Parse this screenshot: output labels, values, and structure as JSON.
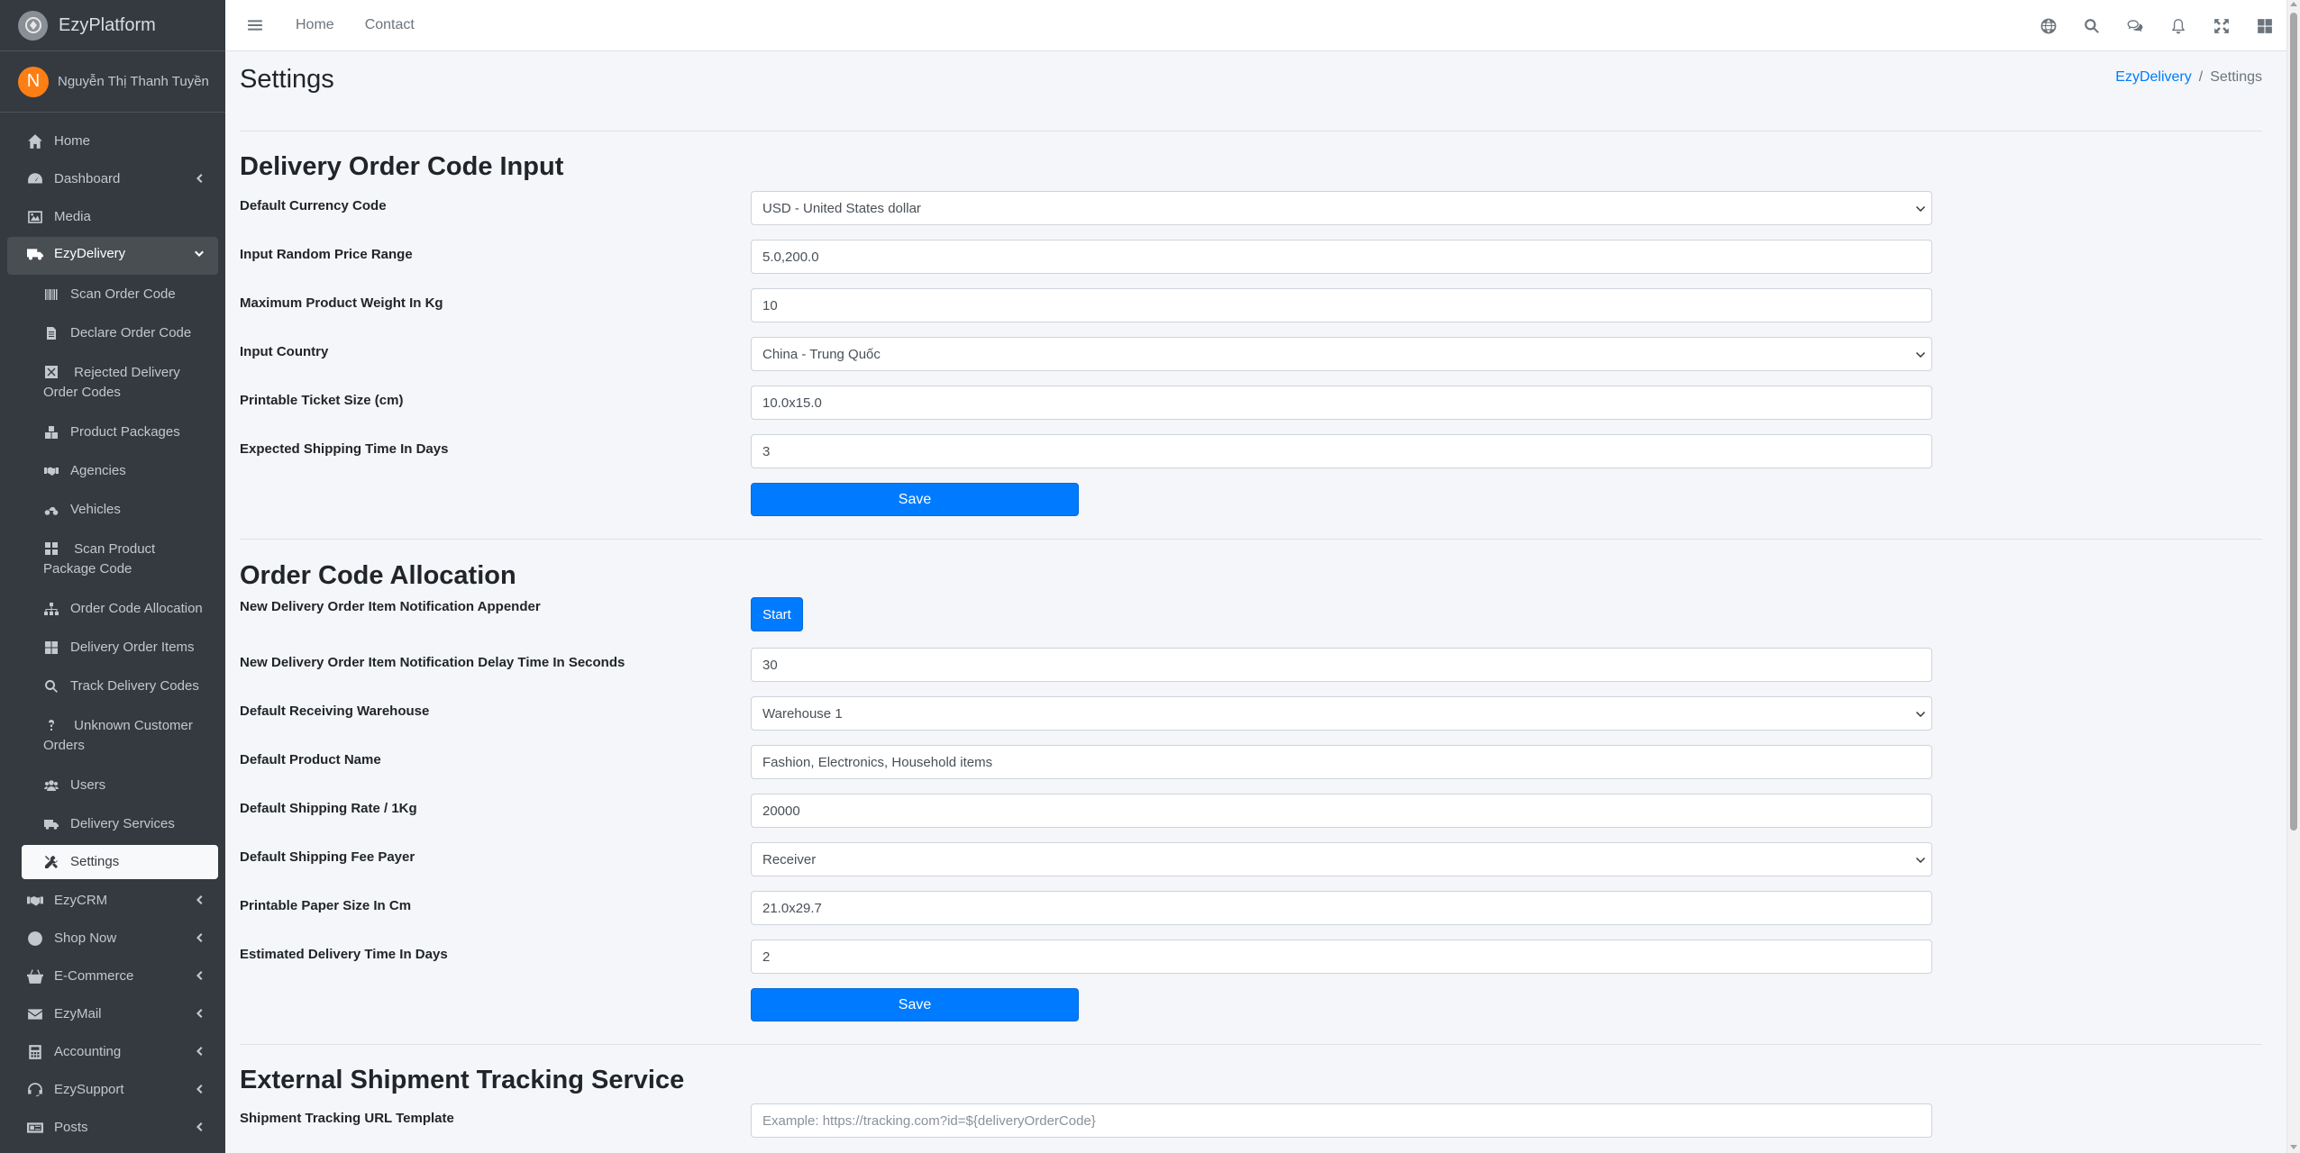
{
  "brand": {
    "name": "EzyPlatform"
  },
  "user": {
    "initial": "N",
    "name": "Nguyễn Thị Thanh Tuyền"
  },
  "sidebar": {
    "items_top": [
      {
        "label": "Home",
        "icon": "home-icon"
      },
      {
        "label": "Dashboard",
        "icon": "dashboard-icon"
      },
      {
        "label": "Media",
        "icon": "image-icon"
      }
    ],
    "active_parent": {
      "label": "EzyDelivery",
      "icon": "truck-icon"
    },
    "sub_items": [
      {
        "label": "Scan Order Code",
        "icon": "barcode-icon"
      },
      {
        "label": "Declare Order Code",
        "icon": "file-icon"
      },
      {
        "label": "Rejected Delivery Order Codes",
        "icon": "x-square-icon"
      },
      {
        "label": "Product Packages",
        "icon": "boxes-icon"
      },
      {
        "label": "Agencies",
        "icon": "handshake-icon"
      },
      {
        "label": "Vehicles",
        "icon": "motorcycle-icon"
      },
      {
        "label": "Scan Product Package Code",
        "icon": "grid-icon"
      },
      {
        "label": "Order Code Allocation",
        "icon": "sitemap-icon"
      },
      {
        "label": "Delivery Order Items",
        "icon": "table-icon"
      },
      {
        "label": "Track Delivery Codes",
        "icon": "search-icon"
      },
      {
        "label": "Unknown Customer Orders",
        "icon": "question-icon"
      },
      {
        "label": "Users",
        "icon": "users-icon"
      },
      {
        "label": "Delivery Services",
        "icon": "truck-icon"
      },
      {
        "label": "Settings",
        "icon": "tools-icon"
      }
    ],
    "items_bottom": [
      {
        "label": "EzyCRM",
        "icon": "handshake-icon"
      },
      {
        "label": "Shop Now",
        "icon": "circle-icon"
      },
      {
        "label": "E-Commerce",
        "icon": "basket-icon"
      },
      {
        "label": "EzyMail",
        "icon": "envelope-icon"
      },
      {
        "label": "Accounting",
        "icon": "calculator-icon"
      },
      {
        "label": "EzySupport",
        "icon": "support-icon"
      },
      {
        "label": "Posts",
        "icon": "posts-icon"
      }
    ]
  },
  "topbar": {
    "links": [
      "Home",
      "Contact"
    ],
    "icons": [
      "globe-icon",
      "search-icon",
      "comments-icon",
      "bell-icon",
      "expand-icon",
      "apps-icon"
    ]
  },
  "page": {
    "title": "Settings",
    "breadcrumb": {
      "parent": "EzyDelivery",
      "separator": "/",
      "current": "Settings"
    }
  },
  "section1": {
    "title": "Delivery Order Code Input",
    "fields": [
      {
        "label": "Default Currency Code",
        "value": "USD - United States dollar",
        "type": "select"
      },
      {
        "label": "Input Random Price Range",
        "value": "5.0,200.0",
        "type": "input"
      },
      {
        "label": "Maximum Product Weight In Kg",
        "value": "10",
        "type": "input"
      },
      {
        "label": "Input Country",
        "value": "China - Trung Quốc",
        "type": "select"
      },
      {
        "label": "Printable Ticket Size (cm)",
        "value": "10.0x15.0",
        "type": "input"
      },
      {
        "label": "Expected Shipping Time In Days",
        "value": "3",
        "type": "input"
      }
    ],
    "save_label": "Save"
  },
  "section2": {
    "title": "Order Code Allocation",
    "appender": {
      "label": "New Delivery Order Item Notification Appender",
      "button": "Start"
    },
    "fields": [
      {
        "label": "New Delivery Order Item Notification Delay Time In Seconds",
        "value": "30",
        "type": "input"
      },
      {
        "label": "Default Receiving Warehouse",
        "value": "Warehouse 1",
        "type": "select"
      },
      {
        "label": "Default Product Name",
        "value": "Fashion, Electronics, Household items",
        "type": "input"
      },
      {
        "label": "Default Shipping Rate / 1Kg",
        "value": "20000",
        "type": "input"
      },
      {
        "label": "Default Shipping Fee Payer",
        "value": "Receiver",
        "type": "select"
      },
      {
        "label": "Printable Paper Size In Cm",
        "value": "21.0x29.7",
        "type": "input"
      },
      {
        "label": "Estimated Delivery Time In Days",
        "value": "2",
        "type": "input"
      }
    ],
    "save_label": "Save"
  },
  "section3": {
    "title": "External Shipment Tracking Service",
    "fields": [
      {
        "label": "Shipment Tracking URL Template",
        "value": "",
        "placeholder": "Example: https://tracking.com?id=${deliveryOrderCode}",
        "type": "input"
      }
    ]
  },
  "colors": {
    "sidebar_bg": "#343a40",
    "primary": "#007bff",
    "content_bg": "#f4f6f9",
    "avatar": "#fd7e14"
  }
}
